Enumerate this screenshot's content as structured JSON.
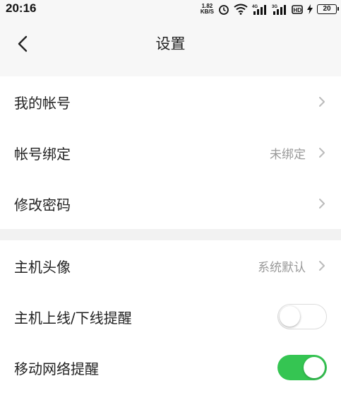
{
  "status_bar": {
    "time": "20:16",
    "net_speed_value": "1.82",
    "net_speed_unit": "KB/S",
    "battery": "20",
    "icons": [
      "alarm-icon",
      "wifi-icon",
      "signal-4g-icon",
      "signal-3g-icon",
      "hd-icon",
      "charging-icon",
      "battery-icon"
    ]
  },
  "header": {
    "title": "设置",
    "back_icon": "chevron-left-icon"
  },
  "account_group": {
    "items": [
      {
        "label": "我的帐号",
        "value": ""
      },
      {
        "label": "帐号绑定",
        "value": "未绑定"
      },
      {
        "label": "修改密码",
        "value": ""
      }
    ]
  },
  "host_group": {
    "items": [
      {
        "label": "主机头像",
        "value": "系统默认"
      },
      {
        "label": "主机上线/下线提醒",
        "toggle": false
      },
      {
        "label": "移动网络提醒",
        "toggle": true
      }
    ]
  },
  "colors": {
    "toggle_on": "#35c552",
    "background": "#f2f2f2",
    "secondary_text": "#999999"
  }
}
